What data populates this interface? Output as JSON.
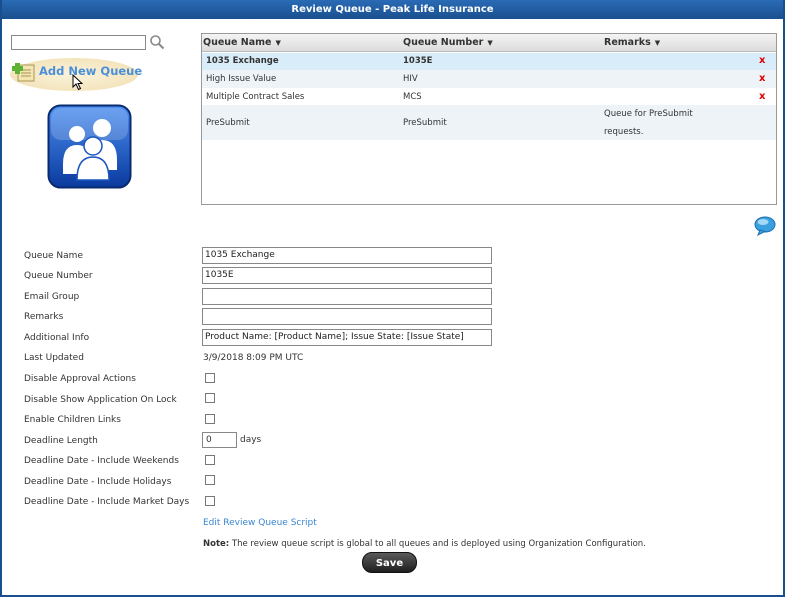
{
  "window": {
    "title": "Review Queue - Peak Life Insurance"
  },
  "sidebar": {
    "search": {
      "value": "",
      "placeholder": ""
    },
    "add_queue_label": "Add New Queue"
  },
  "grid": {
    "columns": [
      "Queue Name",
      "Queue Number",
      "Remarks"
    ],
    "sort_arrow": "▼",
    "delete_glyph": "x",
    "rows": [
      {
        "name": "1035 Exchange",
        "number": "1035E",
        "remarks": "",
        "selected": true
      },
      {
        "name": "High Issue Value",
        "number": "HIV",
        "remarks": ""
      },
      {
        "name": "Multiple Contract Sales",
        "number": "MCS",
        "remarks": ""
      },
      {
        "name": "PreSubmit",
        "number": "PreSubmit",
        "remarks_line1": "Queue for PreSubmit",
        "remarks_line2": "requests."
      }
    ]
  },
  "form": {
    "labels": {
      "queue_name": "Queue Name",
      "queue_number": "Queue Number",
      "email_group": "Email Group",
      "remarks": "Remarks",
      "additional_info": "Additional Info",
      "last_updated": "Last Updated",
      "disable_approval": "Disable Approval Actions",
      "disable_show_app": "Disable Show Application On Lock",
      "enable_children": "Enable Children Links",
      "deadline_length": "Deadline Length",
      "include_weekends": "Deadline Date - Include Weekends",
      "include_holidays": "Deadline Date - Include Holidays",
      "include_market_days": "Deadline Date - Include Market Days"
    },
    "values": {
      "queue_name": "1035 Exchange",
      "queue_number": "1035E",
      "email_group": "",
      "remarks": "",
      "additional_info": "Product Name: [Product Name]; Issue State: [Issue State]",
      "last_updated": "3/9/2018 8:09 PM UTC",
      "deadline_length": "0",
      "days_unit": "days"
    },
    "checkboxes": {
      "disable_approval": false,
      "disable_show_app": false,
      "enable_children": false,
      "include_weekends": false,
      "include_holidays": false,
      "include_market_days": false
    },
    "script_link": "Edit Review Queue Script",
    "note_label": "Note:",
    "note_text": "The review queue script is global to all queues and is deployed using Organization Configuration.",
    "save_label": "Save"
  },
  "icons": {
    "search": "search-icon",
    "add_queue": "add-queue-icon",
    "users": "users-icon",
    "chat": "chat-bubble-icon",
    "delete": "delete-icon",
    "cursor": "mouse-pointer-icon"
  },
  "colors": {
    "title_bar": "#1a4f8f",
    "link": "#3a86d0",
    "delete": "#e00000",
    "selected_row": "#d9ecf9"
  }
}
